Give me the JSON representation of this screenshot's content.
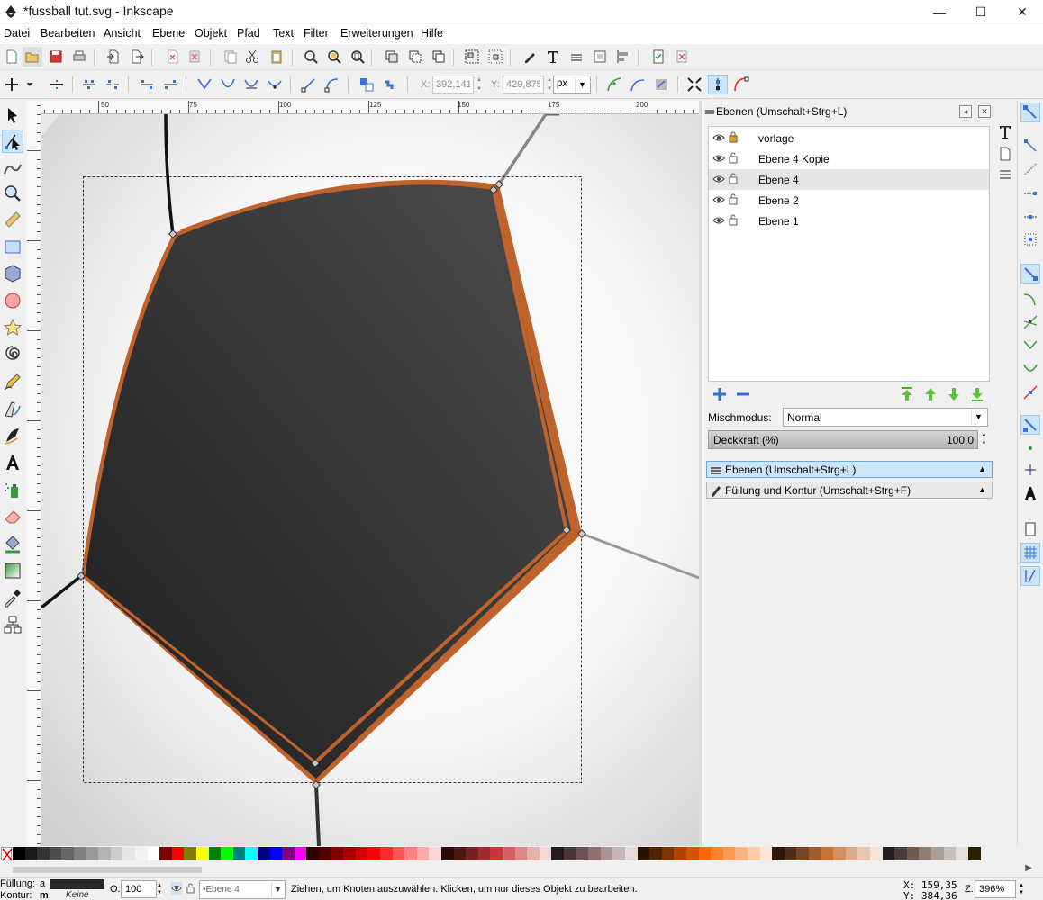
{
  "window": {
    "title": "*fussball tut.svg - Inkscape",
    "minimize": "—",
    "maximize": "☐",
    "close": "✕"
  },
  "menu": [
    "Datei",
    "Bearbeiten",
    "Ansicht",
    "Ebene",
    "Objekt",
    "Pfad",
    "Text",
    "Filter",
    "Erweiterungen",
    "Hilfe"
  ],
  "controls": {
    "x_label": "X:",
    "x_value": "392,141",
    "y_label": "Y:",
    "y_value": "429,875",
    "unit": "px"
  },
  "ruler": {
    "h_ticks": [
      "50",
      "75",
      "100",
      "125",
      "150",
      "175",
      "200"
    ]
  },
  "layers_panel": {
    "title": "Ebenen (Umschalt+Strg+L)",
    "layers": [
      {
        "name": "vorlage",
        "locked": true,
        "selected": false
      },
      {
        "name": "Ebene 4 Kopie",
        "locked": false,
        "selected": false
      },
      {
        "name": "Ebene 4",
        "locked": false,
        "selected": true
      },
      {
        "name": "Ebene 2",
        "locked": false,
        "selected": false
      },
      {
        "name": "Ebene 1",
        "locked": false,
        "selected": false
      }
    ],
    "blend_label": "Mischmodus:",
    "blend_value": "Normal",
    "opacity_label": "Deckkraft (%)",
    "opacity_value": "100,0",
    "opacity_fraction": 1.0
  },
  "dock_tabs": [
    {
      "label": "Ebenen (Umschalt+Strg+L)",
      "active": true
    },
    {
      "label": "Füllung und Kontur (Umschalt+Strg+F)",
      "active": false
    }
  ],
  "statusbar": {
    "fill_label": "Füllung:",
    "fill_value": "a",
    "stroke_label": "Kontur:",
    "stroke_value": "m",
    "stroke_none": "Keine",
    "opacity_label": "O:",
    "opacity_value": "100",
    "layer": "•Ebene 4",
    "message": "Ziehen, um Knoten auszuwählen. Klicken, um nur dieses Objekt zu bearbeiten.",
    "cursor_x": "X:  159,35",
    "cursor_y": "Y:  384,36",
    "zoom_label": "Z:",
    "zoom_value": "396%"
  },
  "colors": {
    "fill_dark": "#262626",
    "stroke_orange": "#c0622b",
    "accent_blue": "#cce4f7",
    "palette": [
      "#000000",
      "#1a1a1a",
      "#333333",
      "#4d4d4d",
      "#666666",
      "#808080",
      "#999999",
      "#b3b3b3",
      "#cccccc",
      "#e6e6e6",
      "#f2f2f2",
      "#ffffff",
      "#800000",
      "#ff0000",
      "#808000",
      "#ffff00",
      "#008000",
      "#00ff00",
      "#008080",
      "#00ffff",
      "#000080",
      "#0000ff",
      "#800080",
      "#ff00ff",
      "#2b0000",
      "#550000",
      "#800000",
      "#aa0000",
      "#d40000",
      "#ff0000",
      "#ff2a2a",
      "#ff5555",
      "#ff8080",
      "#ffaaaa",
      "#ffd5d5",
      "#280b0b",
      "#501616",
      "#782121",
      "#a02c2c",
      "#c83737",
      "#d35f5f",
      "#de8787",
      "#e9afaf",
      "#f4d7d7",
      "#241c1c",
      "#483737",
      "#6c5353",
      "#916f6f",
      "#ac9393",
      "#c8b7b7",
      "#e3dbdb",
      "#2b1100",
      "#552200",
      "#803300",
      "#aa4400",
      "#d45500",
      "#ff6600",
      "#ff7f2a",
      "#ff9955",
      "#ffb380",
      "#ffccaa",
      "#ffe6d5",
      "#28170b",
      "#502d16",
      "#784421",
      "#a05a2c",
      "#c87137",
      "#d38d5f",
      "#deaa87",
      "#e9c6af",
      "#f4e3d7",
      "#241f1c",
      "#483e37",
      "#6c5d53",
      "#917c6f",
      "#ac9d93",
      "#c8beb7",
      "#e3dedb",
      "#2b2200"
    ]
  },
  "icons": {
    "file": [
      "new-document-icon",
      "open-icon",
      "save-icon",
      "print-icon",
      "import-icon",
      "export-icon",
      "undo-icon",
      "redo-icon",
      "copy-icon",
      "cut-icon",
      "paste-icon",
      "zoom-selection-icon",
      "zoom-drawing-icon",
      "zoom-page-icon",
      "duplicate-icon",
      "clone-icon",
      "unlink-clone-icon",
      "group-icon",
      "ungroup-icon",
      "xml-editor-icon",
      "text-tool-icon",
      "layers-icon",
      "transform-icon",
      "align-icon",
      "document-properties-icon",
      "preferences-icon"
    ]
  }
}
